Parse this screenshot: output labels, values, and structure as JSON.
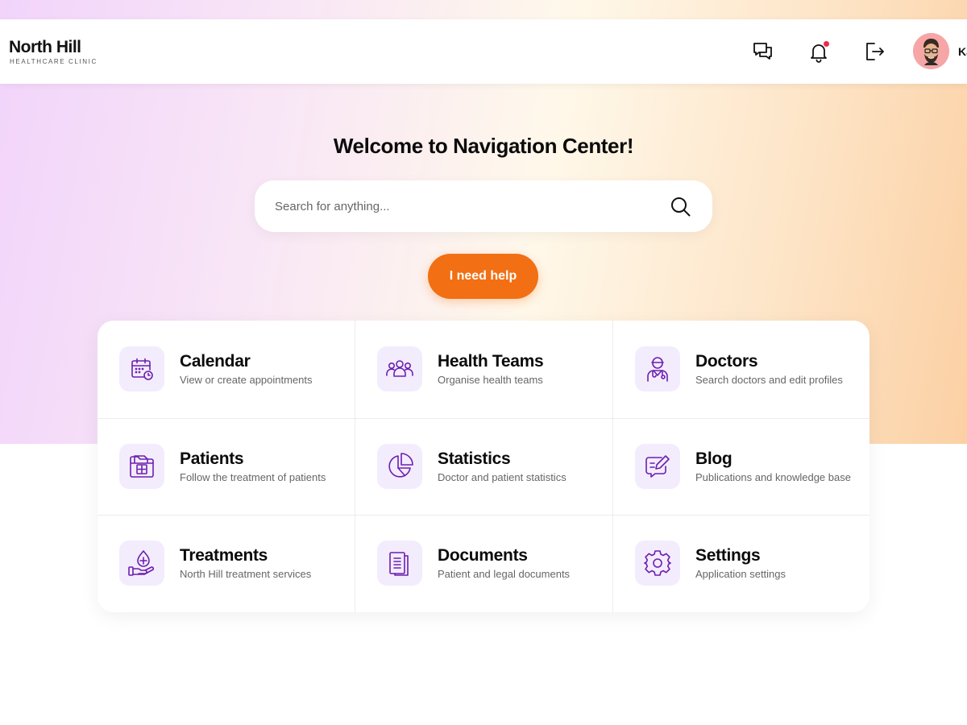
{
  "brand": {
    "title": "North Hill",
    "subtitle": "HEALTHCARE CLINIC"
  },
  "header": {
    "icons": [
      "chat-icon",
      "bell-icon",
      "logout-icon"
    ],
    "notification_dot_color": "#f0284a",
    "user_name": "Ka"
  },
  "hero": {
    "welcome": "Welcome to Navigation Center!",
    "search_placeholder": "Search for anything...",
    "help_button": "I need help",
    "help_button_color": "#f26f14"
  },
  "tiles": [
    {
      "title": "Calendar",
      "desc": "View or create appointments",
      "icon": "calendar-icon"
    },
    {
      "title": "Health Teams",
      "desc": "Organise health teams",
      "icon": "people-group-icon"
    },
    {
      "title": "Doctors",
      "desc": "Search doctors and edit profiles",
      "icon": "doctor-icon"
    },
    {
      "title": "Patients",
      "desc": "Follow the treatment of patients",
      "icon": "patient-folder-icon"
    },
    {
      "title": "Statistics",
      "desc": "Doctor and patient statistics",
      "icon": "pie-chart-icon"
    },
    {
      "title": "Blog",
      "desc": "Publications and knowledge base",
      "icon": "edit-note-icon"
    },
    {
      "title": "Treatments",
      "desc": "North Hill treatment services",
      "icon": "hand-drop-icon"
    },
    {
      "title": "Documents",
      "desc": "Patient and legal documents",
      "icon": "documents-icon"
    },
    {
      "title": "Settings",
      "desc": "Application settings",
      "icon": "gear-icon"
    }
  ],
  "colors": {
    "icon_purple": "#6c1fb0",
    "icon_bg": "#f3ecfd"
  }
}
